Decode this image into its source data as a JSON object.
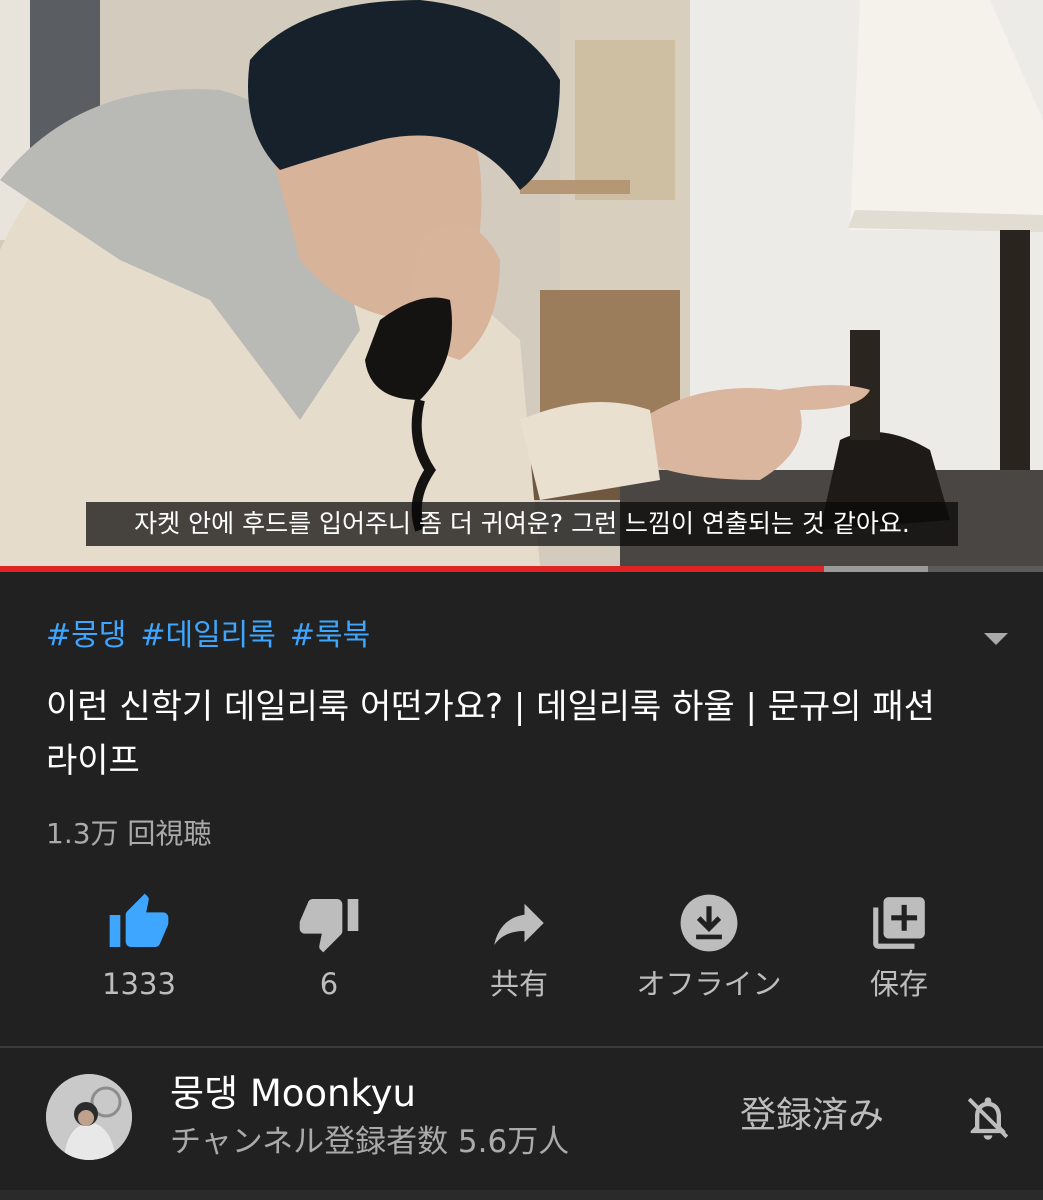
{
  "video": {
    "subtitle": "자켓 안에 후드를 입어주니 좀 더 귀여운? 그런 느낌이 연출되는 것 같아요.",
    "progress_played": 0.79,
    "progress_buffered": 0.89
  },
  "hashtags": [
    "#뭉댕",
    "#데일리룩",
    "#룩북"
  ],
  "title": "이런 신학기 데일리룩 어떤가요? | 데일리룩 하울 | 문규의 패션 라이프",
  "views": "1.3万 回視聴",
  "actions": {
    "like": {
      "label": "1333",
      "icon": "thumbs-up-icon"
    },
    "dislike": {
      "label": "6",
      "icon": "thumbs-down-icon"
    },
    "share": {
      "label": "共有",
      "icon": "share-icon"
    },
    "offline": {
      "label": "オフライン",
      "icon": "download-icon"
    },
    "save": {
      "label": "保存",
      "icon": "playlist-add-icon"
    }
  },
  "channel": {
    "name": "뭉댕 Moonkyu",
    "subscribers": "チャンネル登録者数 5.6万人",
    "subscribe_state": "登録済み",
    "bell_icon": "notifications-off-icon"
  },
  "colors": {
    "background": "#212121",
    "accent_link": "#3ea6ff",
    "like_active": "#3ea6ff",
    "progress_played": "#e02424"
  }
}
